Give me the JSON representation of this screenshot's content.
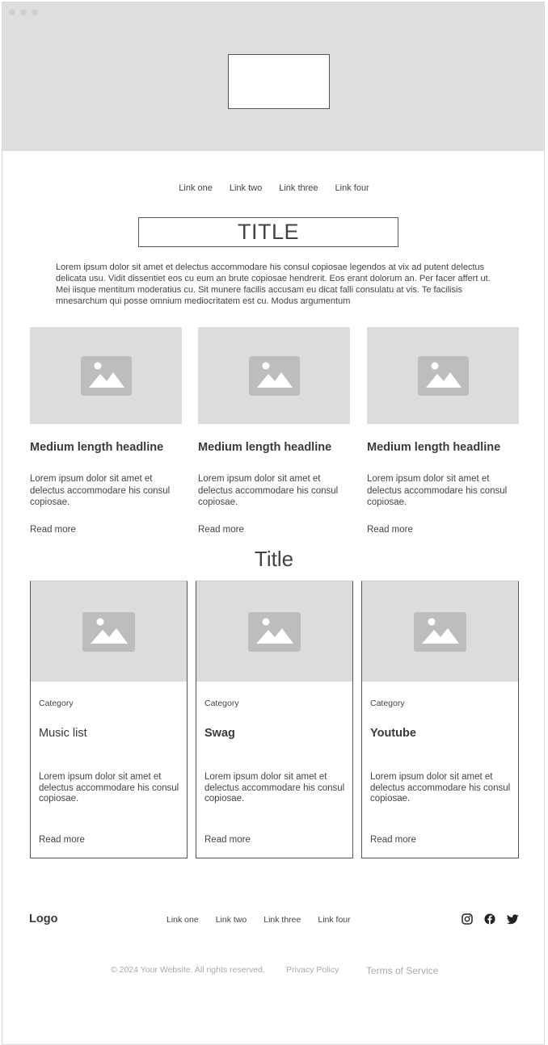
{
  "nav": {
    "links": [
      "Link one",
      "Link two",
      "Link three",
      "Link four"
    ]
  },
  "hero": {
    "title": "TITLE"
  },
  "intro": "Lorem ipsum dolor sit amet et delectus accommodare his consul copiosae legendos at vix ad putent delectus delicata usu. Vidit dissentiet eos cu eum an brute copiosae hendrerit. Eos erant dolorum an. Per facer affert ut. Mei iisque mentitum moderatius cu. Sit munere facilis accusam eu dicat falli consulatu at vis. Te facilisis mnesarchum qui posse omnium mediocritatem est cu. Modus argumentum",
  "features": [
    {
      "headline": "Medium length headline",
      "body": "Lorem ipsum dolor sit amet et delectus accommodare his consul copiosae.",
      "link": "Read more"
    },
    {
      "headline": "Medium length headline",
      "body": "Lorem ipsum dolor sit amet et delectus accommodare his consul copiosae.",
      "link": "Read more"
    },
    {
      "headline": "Medium length headline",
      "body": "Lorem ipsum dolor sit amet et delectus accommodare his consul copiosae.",
      "link": "Read more"
    }
  ],
  "blog": {
    "title": "Title",
    "cards": [
      {
        "category": "Category",
        "name": "Music list",
        "body": "Lorem ipsum dolor sit amet et delectus accommodare his consul copiosae.",
        "link": "Read more"
      },
      {
        "category": "Category",
        "name": "Swag",
        "body": "Lorem ipsum dolor sit amet et delectus accommodare his consul copiosae.",
        "link": "Read more"
      },
      {
        "category": "Category",
        "name": "Youtube",
        "body": "Lorem ipsum dolor sit amet et delectus accommodare his consul copiosae.",
        "link": "Read more"
      }
    ]
  },
  "footer": {
    "logo": "Logo",
    "links": [
      "Link one",
      "Link two",
      "Link three",
      "Link four"
    ],
    "social_icons": [
      "instagram-icon",
      "facebook-icon",
      "twitter-icon"
    ],
    "copyright": "© 2024 Your Website. All rights reserved.",
    "privacy": "Privacy Policy",
    "terms": "Terms of Service"
  },
  "colors": {
    "placeholder": "#dcdcdc",
    "placeholder_icon": "#bdbdbd",
    "text": "#444444"
  }
}
